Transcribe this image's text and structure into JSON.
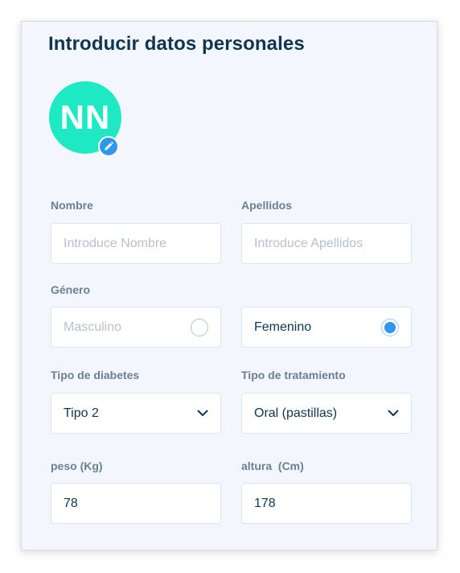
{
  "header": {
    "title": "Introducir datos personales"
  },
  "avatar": {
    "initials": "NN",
    "edit_icon": "pencil-icon"
  },
  "form": {
    "nombre": {
      "label": "Nombre",
      "placeholder": "Introduce Nombre",
      "value": ""
    },
    "apellidos": {
      "label": "Apellidos",
      "placeholder": "Introduce Apellidos",
      "value": ""
    },
    "genero": {
      "label": "Género",
      "options": [
        {
          "label": "Masculino",
          "selected": false
        },
        {
          "label": "Femenino",
          "selected": true
        }
      ]
    },
    "tipo_diabetes": {
      "label": "Tipo de diabetes",
      "selected": "Tipo 2"
    },
    "tipo_tratamiento": {
      "label": "Tipo de tratamiento",
      "selected": "Oral (pastillas)"
    },
    "peso": {
      "label": "peso (Kg)",
      "value": "78"
    },
    "altura": {
      "label": "altura  (Cm)",
      "value": "178"
    }
  },
  "colors": {
    "title": "#0f3550",
    "avatar_bg": "#1de9c3",
    "accent": "#2f97ef",
    "card_bg": "#f3f7fd"
  }
}
